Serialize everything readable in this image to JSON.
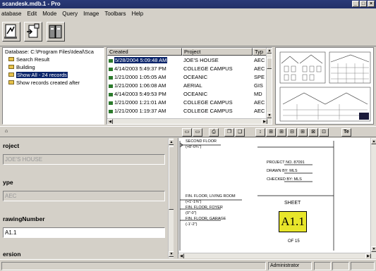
{
  "window": {
    "title": "scandesk.mdb.1 - Pro",
    "controls": {
      "minimize": "_",
      "maximize": "□",
      "close": "×"
    }
  },
  "menu": [
    "atabase",
    "Edit",
    "Mode",
    "Query",
    "Image",
    "Toolbars",
    "Help"
  ],
  "tree": {
    "database_label": "Database: C:\\Program Files\\Ideal\\Sca",
    "items": [
      {
        "label": "Search Result",
        "icon": "folder-icon"
      },
      {
        "label": "Building",
        "icon": "folder-icon"
      },
      {
        "label": "Show All - 24 records",
        "icon": "folder-icon",
        "selected": true
      },
      {
        "label": "Show records created after",
        "icon": "folder-icon"
      }
    ]
  },
  "records": {
    "columns": [
      "Created",
      "Project",
      "Typ"
    ],
    "rows": [
      {
        "created": "5/28/2004 5:09:48 AM",
        "project": "JOE'S HOUSE",
        "type": "AEC",
        "selected": true
      },
      {
        "created": "4/14/2003 5:49:37 PM",
        "project": "COLLEGE CAMPUS",
        "type": "AEC"
      },
      {
        "created": "1/21/2000 1:05:05 AM",
        "project": "OCEANIC",
        "type": "SPE"
      },
      {
        "created": "1/21/2000 1:06:08 AM",
        "project": "AERIAL",
        "type": "GIS"
      },
      {
        "created": "4/14/2003 5:49:53 PM",
        "project": "OCEANIC",
        "type": "MD"
      },
      {
        "created": "1/21/2000 1:21:01 AM",
        "project": "COLLEGE CAMPUS",
        "type": "AEC"
      },
      {
        "created": "1/21/2000 1:19:37 AM",
        "project": "COLLEGE CAMPUS",
        "type": "AEC"
      }
    ]
  },
  "viewer_toolbar": {
    "text_button": "Te"
  },
  "properties": {
    "fields": [
      {
        "label": "roject",
        "value": "JOE'S HOUSE",
        "editable": false
      },
      {
        "label": "ype",
        "value": "AEC",
        "editable": false
      },
      {
        "label": "rawingNumber",
        "value": "A1.1",
        "editable": true
      },
      {
        "label": "ersion",
        "value": "",
        "editable": false
      }
    ]
  },
  "drawing": {
    "levels": [
      {
        "name": "SECOND FLOOR",
        "elev": "(+8'-0¾\")"
      },
      {
        "name": "FIN. FLOOR, LIVING ROOM",
        "elev": "(+1'-1⅜\")"
      },
      {
        "name": "FIN. FLOOR, FOYER",
        "elev": "(0\"-0\")"
      },
      {
        "name": "FIN. FLOOR, GARAGE",
        "elev": "(-1'-2\")"
      }
    ],
    "title_block": {
      "project_no": "PROJECT NO. 87091",
      "drawn_by": "DRAWN BY: MLS",
      "checked_by": "CHECKED BY: MLS",
      "sheet_label": "SHEET",
      "sheet_number": "A1.1",
      "of_label": "OF 15"
    }
  },
  "status": {
    "user": "Administrator"
  },
  "colors": {
    "title_bar": "#223068",
    "selection": "#0a246a",
    "sheet_box": "#e8e62a"
  }
}
